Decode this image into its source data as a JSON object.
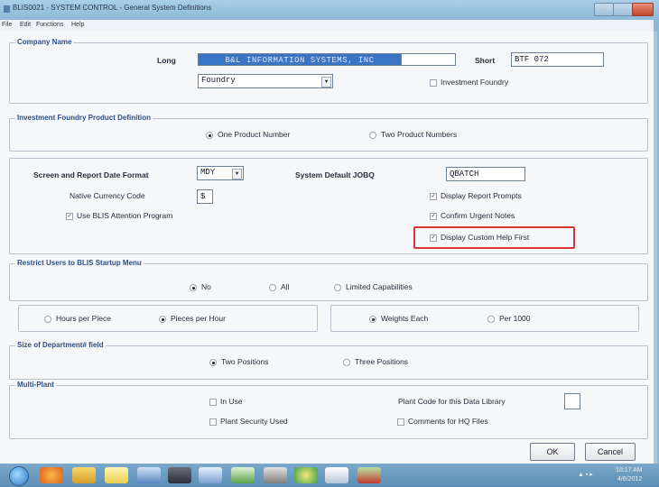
{
  "window": {
    "title": "BLIS0021 - SYSTEM CONTROL - General System Definitions",
    "menu": [
      "File",
      "Edit",
      "Functions",
      "Help"
    ]
  },
  "company": {
    "group_label": "Company Name",
    "long_label": "Long",
    "long_value": "B&L INFORMATION SYSTEMS, INC",
    "short_label": "Short",
    "short_value": "BTF 072",
    "industry_value": "Foundry",
    "investment_foundry_label": "Investment Foundry"
  },
  "product_def": {
    "group_label": "Investment Foundry Product Definition",
    "option1": "One Product Number",
    "option2": "Two Product Numbers"
  },
  "general": {
    "date_format_label": "Screen and Report Date Format",
    "date_format_value": "MDY",
    "currency_label": "Native Currency Code",
    "currency_value": "$",
    "attention_label": "Use BLIS Attention Program",
    "jobq_label": "System Default JOBQ",
    "jobq_value": "QBATCH",
    "report_prompts_label": "Display Report Prompts",
    "urgent_notes_label": "Confirm Urgent Notes",
    "custom_help_label": "Display Custom Help First"
  },
  "restrict": {
    "group_label": "Restrict Users to BLIS Startup Menu",
    "no": "No",
    "all": "All",
    "limited": "Limited Capabilities"
  },
  "rates": {
    "hours_per_piece": "Hours per Piece",
    "pieces_per_hour": "Pieces per Hour",
    "weights_each": "Weights Each",
    "per_1000": "Per 1000"
  },
  "dept": {
    "group_label": "Size of Department# field",
    "two": "Two Positions",
    "three": "Three Positions"
  },
  "multiplant": {
    "group_label": "Multi-Plant",
    "in_use": "In Use",
    "plant_security": "Plant Security Used",
    "plant_code_label": "Plant Code for this Data Library",
    "comments_hq": "Comments for HQ Files"
  },
  "buttons": {
    "ok": "OK",
    "cancel": "Cancel"
  },
  "taskbar": {
    "icons": [
      "start-orb-icon",
      "firefox-icon",
      "explorer-icon",
      "notes-icon",
      "music-icon",
      "terminal-icon",
      "monitor-icon",
      "chart-icon",
      "pen-icon",
      "chrome-icon",
      "paint-icon",
      "photos-icon"
    ],
    "tray_time": "10:17 AM",
    "tray_date": "4/6/2012"
  },
  "colors": {
    "highlight": "#d83636",
    "selection": "#3a74c4",
    "window_bg": "#8fb9d3"
  }
}
